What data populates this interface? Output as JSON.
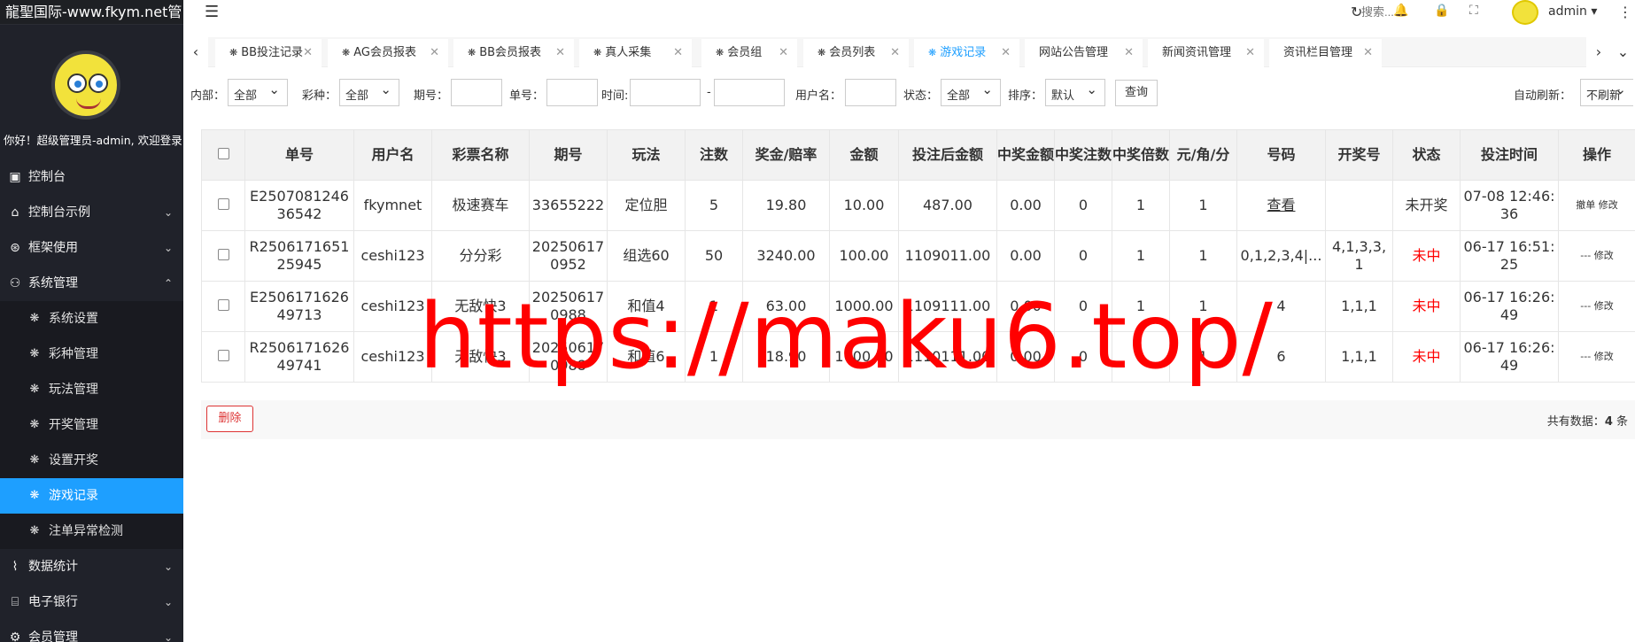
{
  "sidebar": {
    "brand": "龍聖国际-www.fkym.net管",
    "welcome": "你好！超级管理员-admin, 欢迎登录",
    "items": [
      {
        "label": "控制台",
        "icon": "▣",
        "sub": false
      },
      {
        "label": "控制台示例",
        "icon": "⌂",
        "sub": false,
        "arrow": "⌄"
      },
      {
        "label": "框架使用",
        "icon": "⊛",
        "sub": false,
        "arrow": "⌄"
      },
      {
        "label": "系统管理",
        "icon": "⚇",
        "sub": false,
        "arrow": "⌃"
      },
      {
        "label": "系统设置",
        "icon": "❋",
        "sub": true
      },
      {
        "label": "彩种管理",
        "icon": "❋",
        "sub": true
      },
      {
        "label": "玩法管理",
        "icon": "❋",
        "sub": true
      },
      {
        "label": "开奖管理",
        "icon": "❋",
        "sub": true
      },
      {
        "label": "设置开奖",
        "icon": "❋",
        "sub": true
      },
      {
        "label": "游戏记录",
        "icon": "❋",
        "sub": true,
        "active": true
      },
      {
        "label": "注单异常检测",
        "icon": "❋",
        "sub": true
      },
      {
        "label": "数据统计",
        "icon": "⌇",
        "sub": false,
        "arrow": "⌄"
      },
      {
        "label": "电子银行",
        "icon": "⌸",
        "sub": false,
        "arrow": "⌄"
      },
      {
        "label": "会员管理",
        "icon": "⚙",
        "sub": false,
        "arrow": "⌄"
      }
    ]
  },
  "topbar": {
    "fold_icon": "☰",
    "search_placeholder": "搜索...",
    "user": "admin ▾",
    "refresh_icon": "↻",
    "bell_icon": "🔔",
    "lock_icon": "🔒",
    "fullscreen_icon": "⛶",
    "more_icon": "⋮"
  },
  "tabs": {
    "prev": "‹",
    "next": "›",
    "dropdown": "⌄",
    "items": [
      {
        "label": "BB投注记录"
      },
      {
        "label": "AG会员报表"
      },
      {
        "label": "BB会员报表"
      },
      {
        "label": "真人采集"
      },
      {
        "label": "会员组"
      },
      {
        "label": "会员列表"
      },
      {
        "label": "游戏记录",
        "active": true
      },
      {
        "label": "网站公告管理"
      },
      {
        "label": "新闻资讯管理"
      },
      {
        "label": "资讯栏目管理"
      }
    ]
  },
  "filters": {
    "inner_label": "内部：",
    "inner_value": "全部",
    "lottery_label": "彩种：",
    "lottery_value": "全部",
    "issue_label": "期号：",
    "order_label": "单号：",
    "time_label": "时间:",
    "time_sep": "-",
    "username_label": "用户名：",
    "status_label": "状态：",
    "status_value": "全部",
    "sort_label": "排序：",
    "sort_value": "默认",
    "query_button": "查询",
    "auto_refresh_label": "自动刷新：",
    "auto_refresh_value": "不刷新"
  },
  "table": {
    "headers": [
      "单号",
      "用户名",
      "彩票名称",
      "期号",
      "玩法",
      "注数",
      "奖金/赔率",
      "金额",
      "投注后金额",
      "中奖金额",
      "中奖注数",
      "中奖倍数",
      "元/角/分",
      "号码",
      "开奖号",
      "状态",
      "投注时间",
      "操作"
    ],
    "rows": [
      {
        "order": "E250708124636542",
        "user": "fkymnet",
        "lottery": "极速赛车",
        "issue": "33655222",
        "play": "定位胆",
        "bets": "5",
        "odds": "19.80",
        "amount": "10.00",
        "after": "487.00",
        "win_amount": "0.00",
        "win_bets": "0",
        "win_mult": "1",
        "unit": "1",
        "numbers": "查看",
        "draw": "",
        "status": "未开奖",
        "time": "07-08 12:46:36",
        "op1": "撤单",
        "op2": "修改"
      },
      {
        "order": "R250617165125945",
        "user": "ceshi123",
        "lottery": "分分彩",
        "issue": "202506170952",
        "play": "组选60",
        "bets": "50",
        "odds": "3240.00",
        "amount": "100.00",
        "after": "1109011.00",
        "win_amount": "0.00",
        "win_bets": "0",
        "win_mult": "1",
        "unit": "1",
        "numbers": "0,1,2,3,4|...",
        "draw": "4,1,3,3,1",
        "status": "未中",
        "time": "06-17 16:51:25",
        "op1": "---",
        "op2": "修改"
      },
      {
        "order": "E250617162649713",
        "user": "ceshi123",
        "lottery": "无敌快3",
        "issue": "202506170988",
        "play": "和值4",
        "bets": "1",
        "odds": "63.00",
        "amount": "1000.00",
        "after": "1109111.00",
        "win_amount": "0.00",
        "win_bets": "0",
        "win_mult": "1",
        "unit": "1",
        "numbers": "4",
        "draw": "1,1,1",
        "status": "未中",
        "time": "06-17 16:26:49",
        "op1": "---",
        "op2": "修改"
      },
      {
        "order": "R250617162649741",
        "user": "ceshi123",
        "lottery": "无敌快3",
        "issue": "202506170988",
        "play": "和值6",
        "bets": "1",
        "odds": "18.90",
        "amount": "1000.00",
        "after": "1110111.00",
        "win_amount": "0.00",
        "win_bets": "0",
        "win_mult": "1",
        "unit": "1",
        "numbers": "6",
        "draw": "1,1,1",
        "status": "未中",
        "time": "06-17 16:26:49",
        "op1": "---",
        "op2": "修改"
      }
    ]
  },
  "footer": {
    "delete_button": "删除",
    "total_prefix": "共有数据：",
    "total_count": "4",
    "total_suffix": " 条"
  },
  "watermark": "https://maku6.top/",
  "colors": {
    "sidebar_bg": "#20222a",
    "active": "#1e9fff",
    "red": "#ff0000"
  }
}
